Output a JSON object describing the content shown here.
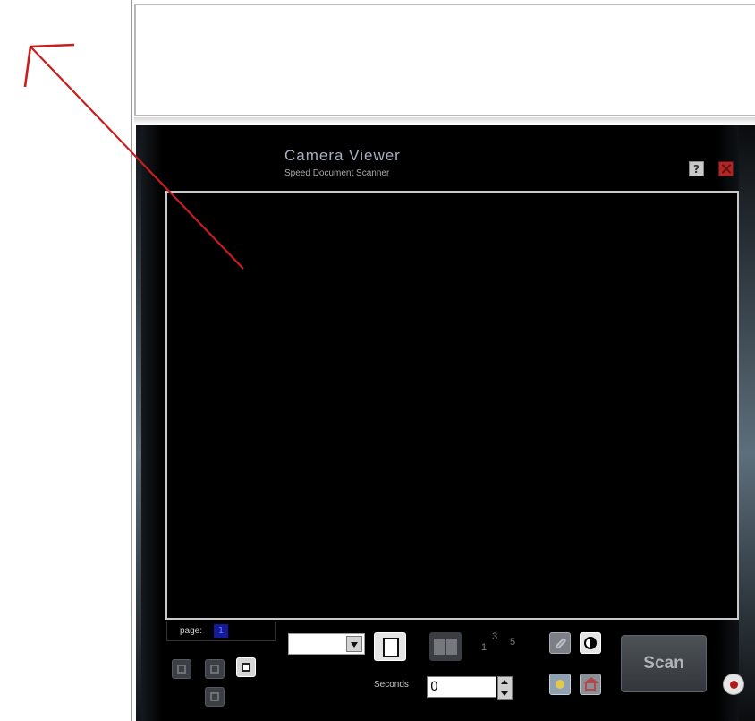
{
  "window": {
    "title": "Camera Viewer",
    "subtitle": "Speed Document Scanner",
    "help_label": "?"
  },
  "controls": {
    "page_label": "page:",
    "page_number": "1",
    "seconds_label": "Seconds",
    "seconds_value": "0",
    "scan_label": "Scan",
    "dropdown_value": ""
  },
  "multi_page_glyphs": [
    "1",
    "3",
    "5"
  ],
  "colors": {
    "annotation_arrow": "#c81e1e",
    "viewer_bg": "#000000",
    "close_button": "#b32626",
    "record_dot": "#b01919"
  }
}
